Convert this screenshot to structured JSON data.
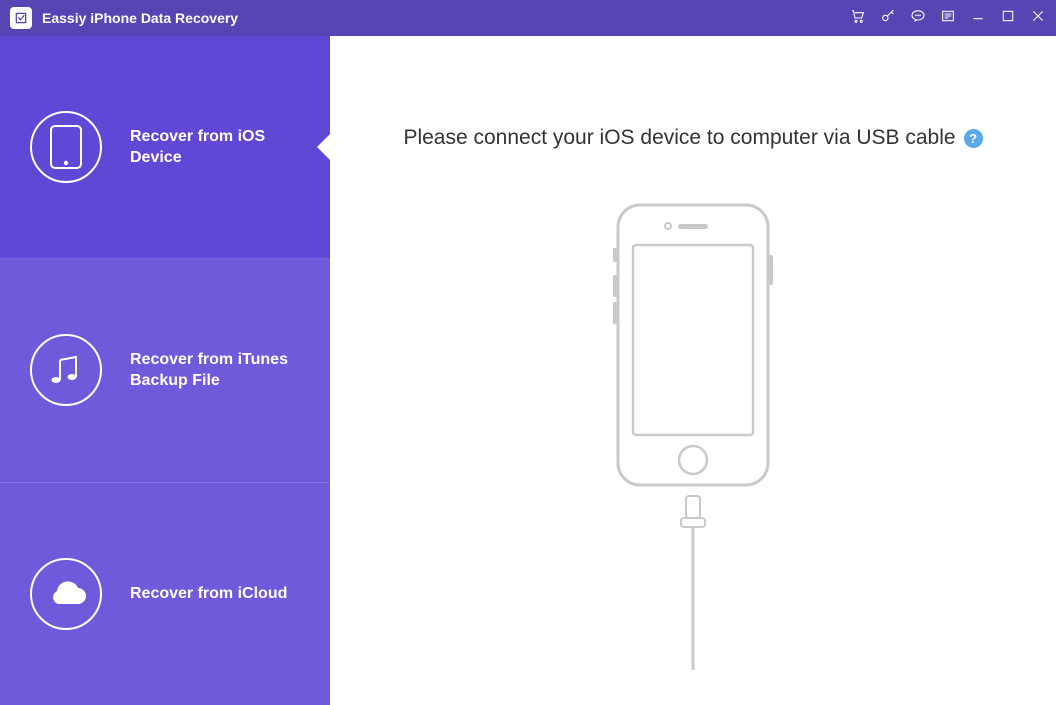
{
  "app": {
    "title": "Eassiy iPhone Data Recovery"
  },
  "sidebar": {
    "items": [
      {
        "label": "Recover from iOS Device"
      },
      {
        "label": "Recover from iTunes Backup File"
      },
      {
        "label": "Recover from iCloud"
      }
    ]
  },
  "main": {
    "instruction": "Please connect your iOS device to computer via USB cable",
    "help": "?"
  }
}
